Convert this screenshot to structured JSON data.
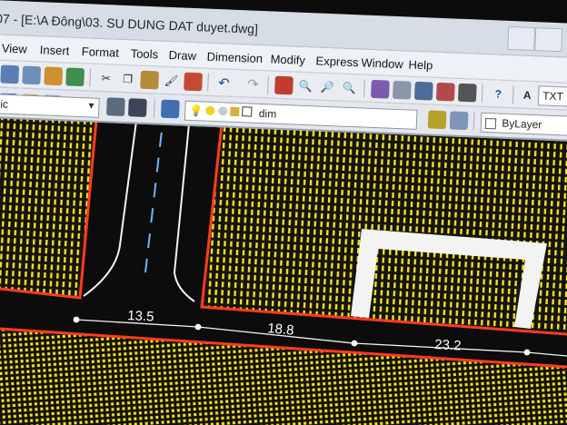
{
  "window": {
    "title": "07 - [E:\\A Đông\\03. SU DUNG DAT duyet.dwg]"
  },
  "menu": [
    "View",
    "Insert",
    "Format",
    "Tools",
    "Draw",
    "Dimension",
    "Modify",
    "Express",
    "Window",
    "Help"
  ],
  "toolbar": {
    "text_style_value": "TXT",
    "layer_value": "dim",
    "color_value": "ByLayer",
    "visual_style_value": "ssic"
  },
  "drawing": {
    "dimensions": [
      "13.5",
      "18.8",
      "23.2"
    ]
  },
  "colors": {
    "hatch_yellow": "#f2e21a",
    "boundary_red": "#ff3b1f",
    "road_black": "#0c0c0c",
    "ui_background": "#e9edf2"
  }
}
